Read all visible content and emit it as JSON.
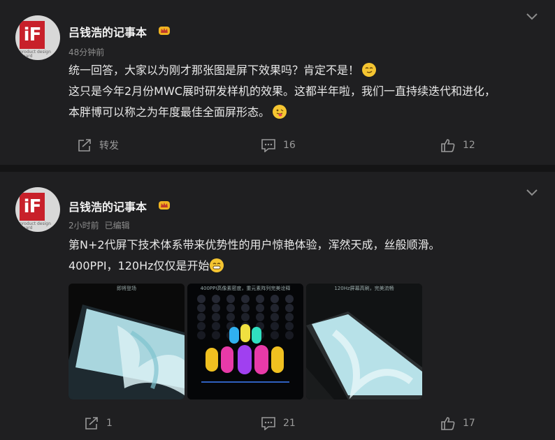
{
  "posts": [
    {
      "author": "吕钱浩的记事本",
      "avatar_text": "iF",
      "avatar_sub": "product design award",
      "time": "48分钟前",
      "edited": "",
      "lines": [
        "统一回答，大家以为刚才那张图是屏下效果吗？肯定不是！",
        "这只是今年2月份MWC展时研发样机的效果。这都半年啦，我们一直持续迭代和进化，",
        "本胖博可以称之为年度最佳全面屏形态。"
      ],
      "repost": "转发",
      "comments": "16",
      "likes": "12"
    },
    {
      "author": "吕钱浩的记事本",
      "avatar_text": "iF",
      "avatar_sub": "product design award",
      "time": "2小时前",
      "edited": "已编辑",
      "lines": [
        "第N+2代屏下技术体系带来优势性的用户惊艳体验，浑然天成，丝般顺滑。",
        "400PPI，120Hz仅仅是开始"
      ],
      "images": [
        {
          "caption": "即将登场"
        },
        {
          "caption": "400PPI高像素密度，重元素阵列完美诠释"
        },
        {
          "caption": "120Hz屏幕高刷，完美流畅"
        }
      ],
      "repost": "1",
      "comments": "21",
      "likes": "17"
    }
  ],
  "colors": {
    "background": "#1f1f21",
    "separator": "#141415",
    "text": "#e8e8e8",
    "muted": "#8d8d8d",
    "vip": "#f0b321"
  },
  "icons": {
    "vip": "crown-icon",
    "chevron": "chevron-down-icon",
    "repost": "share-icon",
    "comment": "comment-icon",
    "like": "thumbs-up-icon"
  }
}
